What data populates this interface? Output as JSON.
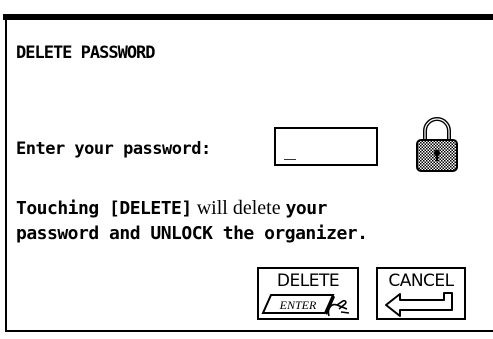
{
  "dialog": {
    "title": "DELETE PASSWORD",
    "prompt_label": "Enter your password:",
    "password_value": "_",
    "warning": {
      "part1": "Touching [DELETE]",
      "part2": " will delete ",
      "part3": "your",
      "part4": "password and UNLOCK the organizer."
    }
  },
  "buttons": {
    "delete_label": "DELETE",
    "enter_label": "ENTER",
    "cancel_label": "CANCEL"
  },
  "icons": {
    "lock": "padlock-icon",
    "enter_key": "enter-key-icon",
    "return_arrow": "return-arrow-icon",
    "pointing_hand": "pointing-hand-icon"
  },
  "colors": {
    "ink": "#000000",
    "background": "#ffffff"
  }
}
